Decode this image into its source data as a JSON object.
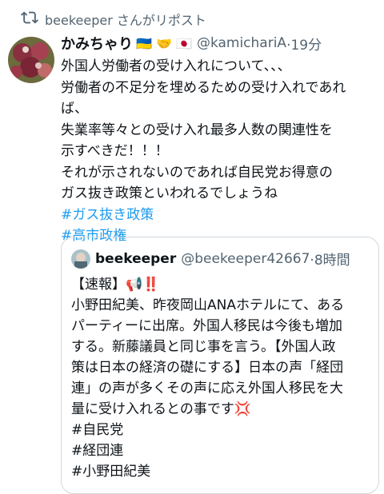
{
  "repost": {
    "text": "beekeeper さんがリポスト"
  },
  "tweet": {
    "display_name": "かみちゃり",
    "flags": "🇺🇦 🤝 🇯🇵",
    "handle": "@kamichariA",
    "time": "·19分",
    "body": "外国人労働者の受け入れについて、、、\n労働者の不足分を埋めるための受け入れであれ\nば、\n失業率等々との受け入れ最多人数の関連性を\n示すべきだ！！！\nそれが示されないのであれば自民党お得意の\nガス抜き政策といわれるでしょうね",
    "hashtags": [
      "#ガス抜き政策",
      "#高市政権"
    ]
  },
  "quote": {
    "display_name": "beekeeper",
    "handle": "@beekeeper42667",
    "time": "·8時間",
    "body": "【速報】📢‼️\n小野田紀美、昨夜岡山ANAホテルにて、ある\nパーティーに出席。外国人移民は今後も増加\nする。新藤議員と同じ事を言う。【外国人政\n策は日本の経済の礎にする】日本の声「経団\n連」の声が多くその声に応え外国人移民を大\n量に受け入れるとの事です💢\n#自民党\n#経団連\n#小野田紀美"
  },
  "colors": {
    "text": "#0f1419",
    "secondary": "#536471",
    "link": "#1d9bf0",
    "border": "#cfd9de"
  }
}
